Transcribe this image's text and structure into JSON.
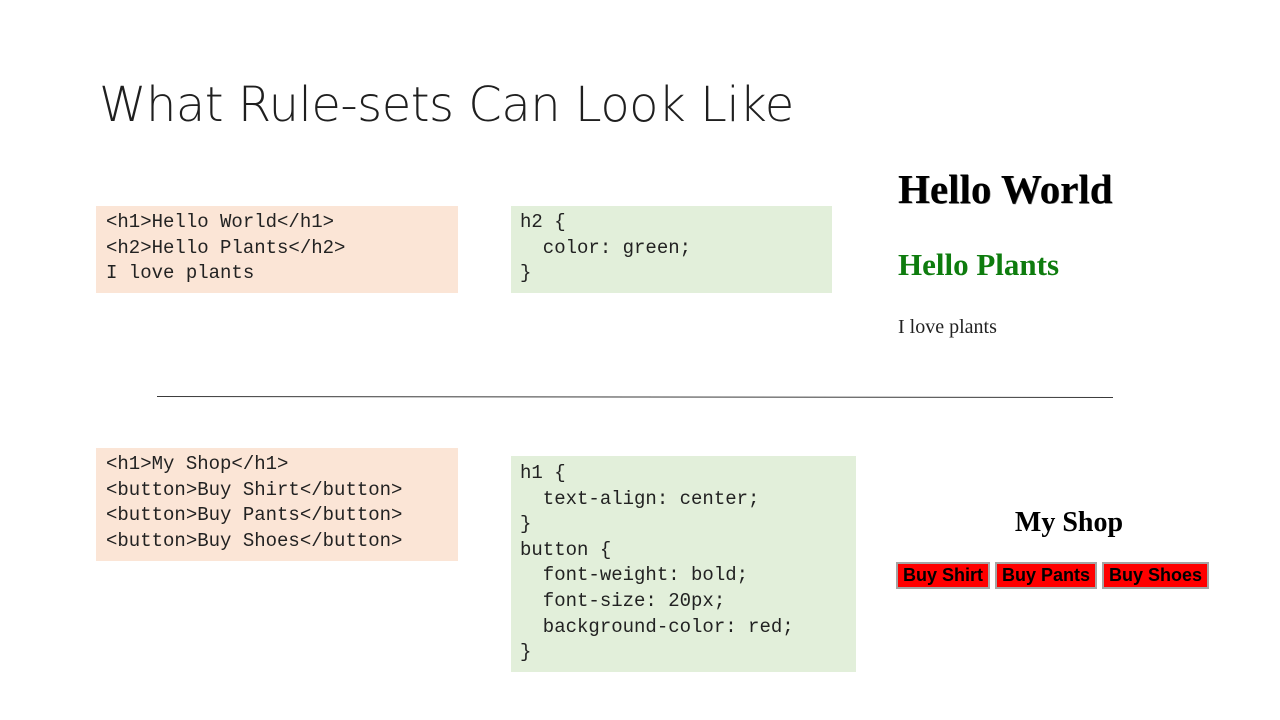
{
  "slide": {
    "title": "What Rule-sets Can Look Like"
  },
  "example1": {
    "html_code": "<h1>Hello World</h1>\n<h2>Hello Plants</h2>\nI love plants",
    "css_code": "h2 {\n  color: green;\n}",
    "preview": {
      "h1": "Hello World",
      "h2": "Hello Plants",
      "text": "I love plants",
      "h2_color": "#0e7c0e"
    }
  },
  "example2": {
    "html_code": "<h1>My Shop</h1>\n<button>Buy Shirt</button>\n<button>Buy Pants</button>\n<button>Buy Shoes</button>",
    "css_code": "h1 {\n  text-align: center;\n}\nbutton {\n  font-weight: bold;\n  font-size: 20px;\n  background-color: red;\n}",
    "preview": {
      "h1": "My Shop",
      "buttons": [
        "Buy Shirt",
        "Buy Pants",
        "Buy Shoes"
      ],
      "button_color": "#ff0000"
    }
  },
  "colors": {
    "html_box": "#fbe5d6",
    "css_box": "#e2efda"
  }
}
